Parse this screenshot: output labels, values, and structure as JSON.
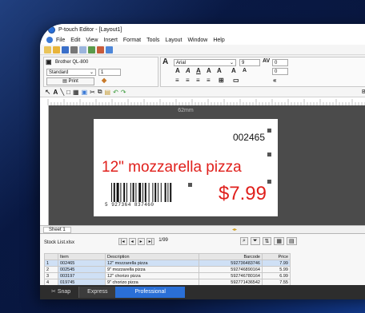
{
  "window": {
    "title": "P-touch Editor - [Layout1]"
  },
  "menu": [
    "File",
    "Edit",
    "View",
    "Insert",
    "Format",
    "Tools",
    "Layout",
    "Window",
    "Help"
  ],
  "printer": {
    "model": "Brother QL-800",
    "mode": "Standard",
    "copies": "1",
    "print_label": "Print"
  },
  "font": {
    "family": "Arial",
    "size": "9",
    "spacing_a": "0",
    "spacing_b": "0"
  },
  "label": {
    "width_label": "62mm",
    "code": "002465",
    "product": "12\" mozzarella pizza",
    "barcode_text": "5 927364 837460",
    "price": "$7.99"
  },
  "sheet": {
    "tab": "Sheet 1"
  },
  "database": {
    "file": "Stock List.xlsx",
    "record_count": "1/99",
    "columns": [
      "",
      "Item",
      "Description",
      "Barcode",
      "Price"
    ],
    "rows": [
      [
        "1",
        "002465",
        "12\" mozzarella pizza",
        "592736483746",
        "7.99"
      ],
      [
        "2",
        "002545",
        "9\" mozzarella pizza",
        "592746890164",
        "5.99"
      ],
      [
        "3",
        "003197",
        "12\" chorizo pizza",
        "592746780164",
        "6.99"
      ],
      [
        "4",
        "019745",
        "9\" chorizo pizza",
        "592771436542",
        "7.55"
      ]
    ]
  },
  "modes": {
    "snap": "Snap",
    "express": "Express",
    "professional": "Professional"
  },
  "colors": {
    "price_red": "#e0201c",
    "mode_active": "#2a6fd6"
  }
}
